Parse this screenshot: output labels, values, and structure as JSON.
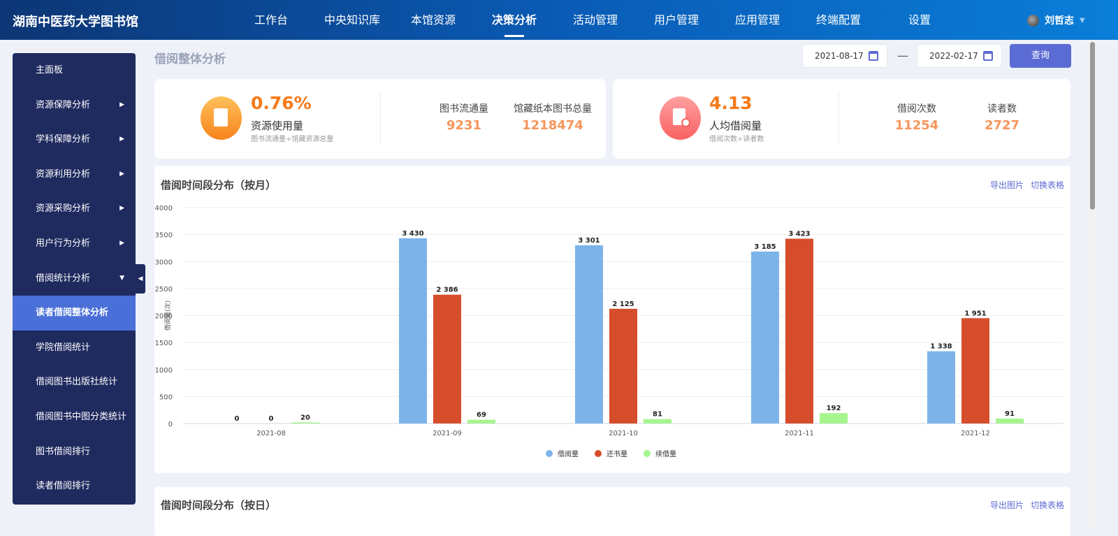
{
  "header": {
    "logo": "湖南中医药大学图书馆",
    "nav": [
      "工作台",
      "中央知识库",
      "本馆资源",
      "决策分析",
      "活动管理",
      "用户管理",
      "应用管理",
      "终端配置",
      "设置"
    ],
    "active_nav": 3,
    "user": "刘哲志"
  },
  "sidebar": {
    "items": [
      {
        "label": "主面板",
        "arrow": ""
      },
      {
        "label": "资源保障分析",
        "arrow": "▶"
      },
      {
        "label": "学科保障分析",
        "arrow": "▶"
      },
      {
        "label": "资源利用分析",
        "arrow": "▶"
      },
      {
        "label": "资源采购分析",
        "arrow": "▶"
      },
      {
        "label": "用户行为分析",
        "arrow": "▶"
      },
      {
        "label": "借阅统计分析",
        "arrow": "▼"
      },
      {
        "label": "读者借阅整体分析",
        "arrow": ""
      },
      {
        "label": "学院借阅统计",
        "arrow": ""
      },
      {
        "label": "借阅图书出版社统计",
        "arrow": ""
      },
      {
        "label": "借阅图书中图分类统计",
        "arrow": ""
      },
      {
        "label": "图书借阅排行",
        "arrow": ""
      },
      {
        "label": "读者借阅排行",
        "arrow": ""
      }
    ],
    "active": 7
  },
  "page": {
    "title": "借阅整体分析",
    "date_from": "2021-08-17",
    "date_sep": "—",
    "date_to": "2022-02-17",
    "query": "查询"
  },
  "card1": {
    "value": "0.76%",
    "label": "资源使用量",
    "formula": "图书流通量÷馆藏资源总量",
    "stats": [
      {
        "t": "图书流通量",
        "v": "9231"
      },
      {
        "t": "馆藏纸本图书总量",
        "v": "1218474"
      }
    ]
  },
  "card2": {
    "value": "4.13",
    "label": "人均借阅量",
    "formula": "借阅次数÷读者数",
    "stats": [
      {
        "t": "借阅次数",
        "v": "11254"
      },
      {
        "t": "读者数",
        "v": "2727"
      }
    ]
  },
  "chart_section": {
    "title": "借阅时间段分布（按月）",
    "export": "导出图片",
    "toggle": "切换表格"
  },
  "day_section": {
    "title": "借阅时间段分布（按日）",
    "export": "导出图片",
    "toggle": "切换表格"
  },
  "chart_data": {
    "type": "bar",
    "title": "借阅时间段分布（按月）",
    "ylabel": "借阅量(次)",
    "ylim": [
      0,
      4000
    ],
    "yticks": [
      0,
      500,
      1000,
      1500,
      2000,
      2500,
      3000,
      3500,
      4000
    ],
    "categories": [
      "2021-08",
      "2021-09",
      "2021-10",
      "2021-11",
      "2021-12"
    ],
    "series": [
      {
        "name": "借阅量",
        "color": "#7cb4ea",
        "values": [
          0,
          3430,
          3301,
          3185,
          1338
        ],
        "labels": [
          "0",
          "3 430",
          "3 301",
          "3 185",
          "1 338"
        ]
      },
      {
        "name": "还书量",
        "color": "#d64d2c",
        "values": [
          0,
          2386,
          2125,
          3423,
          1951
        ],
        "labels": [
          "0",
          "2 386",
          "2 125",
          "3 423",
          "1 951"
        ]
      },
      {
        "name": "续借量",
        "color": "#a6f58f",
        "values": [
          20,
          69,
          81,
          192,
          91
        ],
        "labels": [
          "20",
          "69",
          "81",
          "192",
          "91"
        ]
      }
    ],
    "legend": "bottom"
  }
}
